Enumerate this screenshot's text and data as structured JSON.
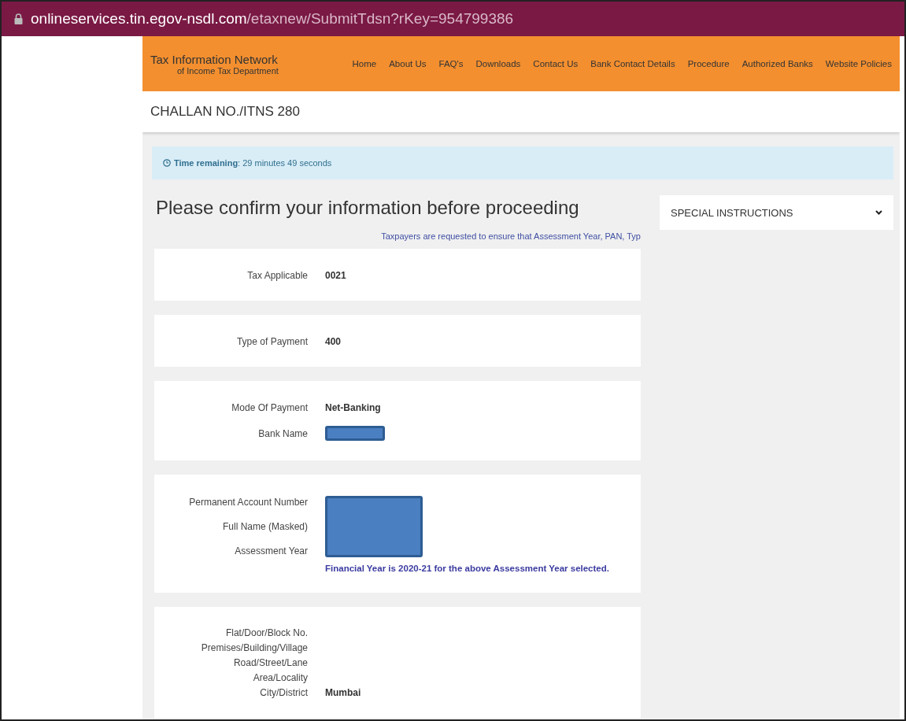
{
  "address_bar": {
    "host": "onlineservices.tin.egov-nsdl.com",
    "path": "/etaxnew/SubmitTdsn?rKey=954799386"
  },
  "brand": {
    "title": "Tax Information Network",
    "subtitle": "of Income Tax Department"
  },
  "nav": [
    "Home",
    "About Us",
    "FAQ's",
    "Downloads",
    "Contact Us",
    "Bank Contact Details",
    "Procedure",
    "Authorized Banks",
    "Website Policies"
  ],
  "page_title": "CHALLAN NO./ITNS 280",
  "timer": {
    "label": "Time remaining",
    "value": ": 29 minutes 49 seconds"
  },
  "heading": "Please confirm your information before proceeding",
  "notice": "Taxpayers are requested to ensure that Assessment Year, PAN, Typ",
  "cards": [
    {
      "rows": [
        {
          "label": "Tax Applicable",
          "value": "0021"
        }
      ]
    },
    {
      "rows": [
        {
          "label": "Type of Payment",
          "value": "400"
        }
      ]
    },
    {
      "rows": [
        {
          "label": "Mode Of Payment",
          "value": "Net-Banking"
        },
        {
          "label": "Bank Name",
          "redacted": true
        }
      ]
    },
    {
      "masked": true,
      "rows": [
        {
          "label": "Permanent Account Number"
        },
        {
          "label": "Full Name (Masked)"
        },
        {
          "label": "Assessment Year"
        }
      ],
      "note": "Financial Year is 2020-21 for the above Assessment Year selected."
    },
    {
      "rows": [
        {
          "label": "Flat/Door/Block No."
        },
        {
          "label": "Premises/Building/Village"
        },
        {
          "label": "Road/Street/Lane"
        },
        {
          "label": "Area/Locality"
        },
        {
          "label": "City/District",
          "value": "Mumbai"
        }
      ]
    }
  ],
  "special_instructions": {
    "title": "SPECIAL INSTRUCTIONS",
    "expanded": false
  }
}
